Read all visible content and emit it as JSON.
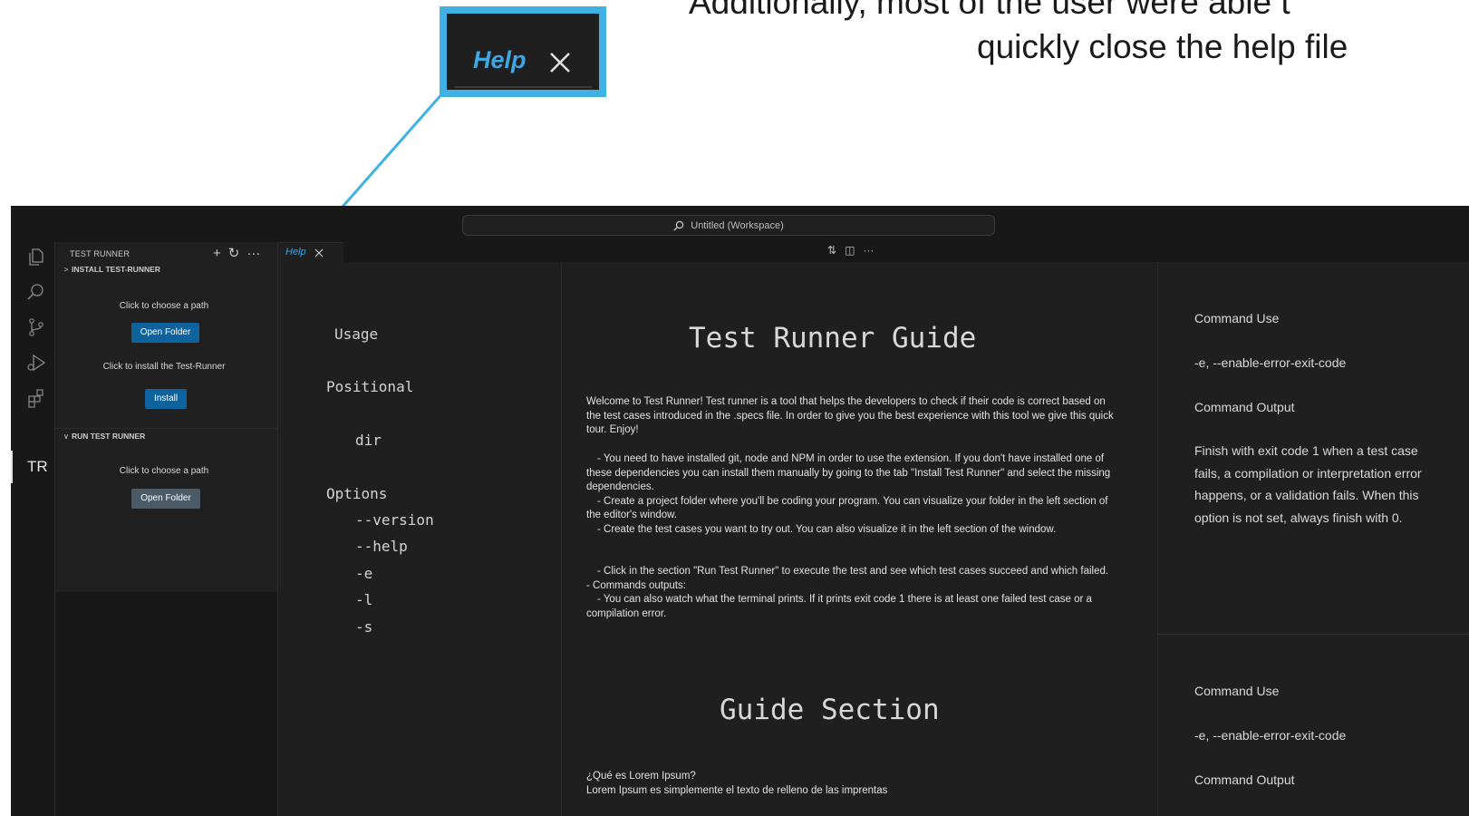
{
  "caption": {
    "line1": "Additionally, most of the user were able t",
    "line2": "quickly close the help file"
  },
  "zoom_callout": {
    "tab_label": "Help"
  },
  "titlebar": {
    "search_text": "Untitled (Workspace)"
  },
  "activity_bar": {
    "icons": [
      "explorer-icon",
      "search-icon",
      "source-control-icon",
      "run-debug-icon",
      "extensions-icon"
    ],
    "custom_label": "TR"
  },
  "sidebar": {
    "title": "TEST RUNNER",
    "actions": [
      "+",
      "↻",
      "···"
    ],
    "section1": {
      "title": "INSTALL TEST-RUNNER",
      "choose_text": "Click to choose a path",
      "open_folder": "Open Folder",
      "install_text": "Click to install the Test-Runner",
      "install_button": "Install"
    },
    "section2": {
      "title": "RUN TEST RUNNER",
      "choose_text": "Click to choose a path",
      "open_folder": "Open Folder"
    }
  },
  "tabs": {
    "active": "Help",
    "actions": [
      "⇅",
      "◫",
      "···"
    ]
  },
  "help_left": {
    "usage": "Usage",
    "positional": "Positional",
    "dir": "dir",
    "options": "Options",
    "option_items": [
      "--version",
      "--help",
      "-e",
      "-l",
      "-s"
    ]
  },
  "help_center": {
    "title": "Test Runner Guide",
    "intro": "Welcome to Test Runner! Test runner is a tool that helps the developers to check if their code is correct based on the test cases introduced in the .specs file. In order to give you the best experience with this tool we give this quick tour. Enjoy!",
    "steps": [
      "- You need to have installed git, node and NPM in order to use the extension. If you don't have installed one of these dependencies you can install them manually by going to the tab \"Install Test Runner\" and select the missing dependencies.",
      "- Create a project folder where you'll be coding your program. You can visualize your folder in the left section of the editor's window.",
      "- Create the test cases you want to try out. You can also visualize it in the left section of the window."
    ],
    "run_step": "- Click in the section \"Run Test Runner\" to execute the test and see which test cases succeed and which failed.",
    "outputs_title": "- Commands outputs:",
    "outputs_text": "- You can also watch what the terminal prints. If it prints exit code 1 there is at least one failed test case or a compilation error.",
    "section_title": "Guide Section",
    "lorem_q": "¿Qué es Lorem Ipsum?",
    "lorem_text": "Lorem Ipsum es simplemente el texto de relleno de las imprentas"
  },
  "help_right": {
    "block1": {
      "use_label": "Command Use",
      "use_value": "-e, --enable-error-exit-code",
      "output_label": "Command Output",
      "output_text": "Finish with exit code 1 when a test case fails, a compilation or interpretation error happens, or a validation fails. When this option is not set, always finish with 0."
    },
    "block2": {
      "use_label": "Command Use",
      "use_value": "-e, --enable-error-exit-code",
      "output_label": "Command Output"
    }
  },
  "colors": {
    "accent_blue": "#3fb1e3",
    "tab_label": "#3ea6e3",
    "button_primary": "#0e639c",
    "editor_bg": "#1f1f1f"
  }
}
